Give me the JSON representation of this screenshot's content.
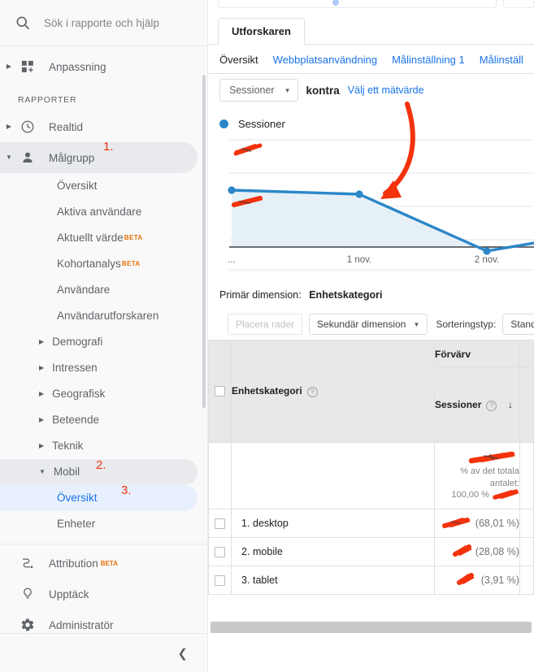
{
  "sidebar": {
    "search": {
      "placeholder": "Sök i rapporte och hjälp",
      "icon": "search-icon"
    },
    "customization": {
      "label": "Anpassning",
      "icon": "customization-icon"
    },
    "section_title": "RAPPORTER",
    "realtime": {
      "label": "Realtid",
      "icon": "clock-icon"
    },
    "audience": {
      "label": "Målgrupp",
      "icon": "person-icon"
    },
    "audience_children": [
      {
        "label": "Översikt",
        "beta": ""
      },
      {
        "label": "Aktiva användare",
        "beta": ""
      },
      {
        "label": "Aktuellt värde",
        "beta": "BETA"
      },
      {
        "label": "Kohortanalys",
        "beta": "BETA"
      },
      {
        "label": "Användare",
        "beta": ""
      },
      {
        "label": "Användarutforskaren",
        "beta": ""
      }
    ],
    "audience_groups": [
      {
        "label": "Demografi"
      },
      {
        "label": "Intressen"
      },
      {
        "label": "Geografisk"
      },
      {
        "label": "Beteende"
      },
      {
        "label": "Teknik"
      }
    ],
    "mobile_group": {
      "label": "Mobil"
    },
    "mobile_children": [
      {
        "label": "Översikt",
        "active": true
      },
      {
        "label": "Enheter",
        "active": false
      }
    ],
    "footer_items": [
      {
        "label": "Attribution",
        "beta": "BETA",
        "icon": "attribution-icon"
      },
      {
        "label": "Upptäck",
        "beta": "",
        "icon": "lightbulb-icon"
      },
      {
        "label": "Administratör",
        "beta": "",
        "icon": "gear-icon"
      }
    ],
    "collapse": {
      "icon": "chevron-left-icon"
    }
  },
  "main": {
    "tab_card": "Utforskaren",
    "subtabs": [
      {
        "label": "Översikt",
        "active": true
      },
      {
        "label": "Webbplatsanvändning",
        "active": false
      },
      {
        "label": "Målinställning 1",
        "active": false
      },
      {
        "label": "Målinställ",
        "active": false
      }
    ],
    "metric_select": "Sessioner",
    "kontra": "kontra",
    "pick_metric": "Välj ett mätvärde",
    "legend_label": "Sessioner",
    "primary_dimension_label": "Primär dimension:",
    "primary_dimension_value": "Enhetskategori",
    "place_rows_placeholder": "Placera rader",
    "secondary_dimension": "Sekundär dimension",
    "sort_type_label": "Sorteringstyp:",
    "sort_type_value": "Standard"
  },
  "table": {
    "group_header": "Förvärv",
    "dim_header": "Enhetskategori",
    "metric_header": "Sessioner",
    "total_percent_label": "% av det totala antalet:",
    "total_percent_value": "100,00 %",
    "total_value_redacted": true,
    "rows": [
      {
        "index": "1.",
        "name": "desktop",
        "value_redacted": true,
        "percent": "(68,01 %)"
      },
      {
        "index": "2.",
        "name": "mobile",
        "value_redacted": true,
        "percent": "(28,08 %)"
      },
      {
        "index": "3.",
        "name": "tablet",
        "value_redacted": true,
        "percent": "(3,91 %)"
      }
    ]
  },
  "annotations": [
    {
      "id": "1",
      "label": "1.",
      "target": "Målgrupp"
    },
    {
      "id": "2",
      "label": "2.",
      "target": "Mobil"
    },
    {
      "id": "3",
      "label": "3.",
      "target": "Översikt"
    }
  ],
  "chart_data": {
    "type": "area",
    "title": "Sessioner",
    "xlabel": "",
    "ylabel": "",
    "series_color": "#2b87c8",
    "fill_color": "#e6f0f7",
    "x": [
      "...",
      "1 nov.",
      "2 nov."
    ],
    "tick_labels": [
      "...",
      "1 nov.",
      "2 nov."
    ],
    "values": [
      100,
      95,
      62,
      68
    ],
    "ylim": [
      0,
      160
    ],
    "grid": true,
    "y_axis_labels_redacted": true,
    "legend_position": "top-left",
    "legend_entries": [
      "Sessioner"
    ]
  },
  "colors": {
    "accent_blue": "#1a73e8",
    "line_blue": "#2b87c8",
    "annotation_red": "#f4320c",
    "beta_orange": "#e8710a",
    "sidebar_bg": "#f9f9f9"
  }
}
